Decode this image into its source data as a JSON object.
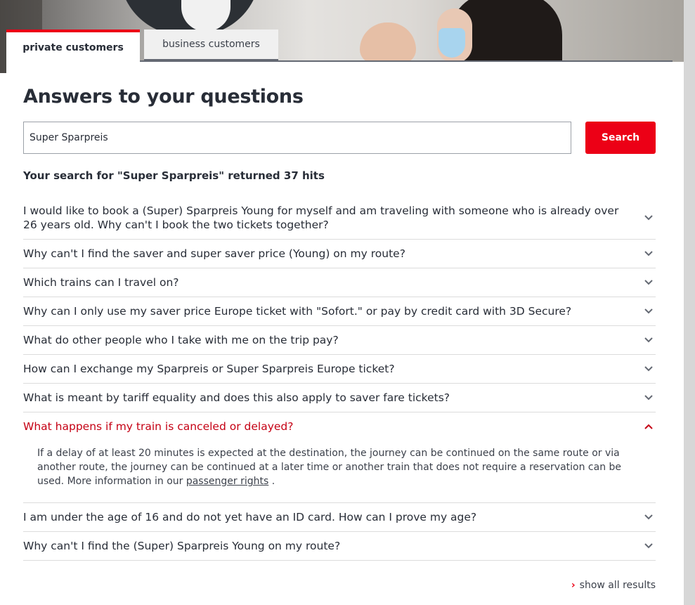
{
  "tabs": {
    "private": "private customers",
    "business": "business customers"
  },
  "page_title": "Answers to your questions",
  "search": {
    "value": "Super Sparpreis",
    "button_label": "Search"
  },
  "result_summary": "Your search for \"Super Sparpreis\" returned 37 hits",
  "faq": [
    {
      "question": "I would like to book a (Super) Sparpreis Young for myself and am traveling with someone who is already over 26 years old. Why can't I book the two tickets together?",
      "open": false
    },
    {
      "question": "Why can't I find the saver and super saver price (Young) on my route?",
      "open": false
    },
    {
      "question": "Which trains can I travel on?",
      "open": false
    },
    {
      "question": "Why can I only use my saver price Europe ticket with \"Sofort.\" or pay by credit card with 3D Secure?",
      "open": false
    },
    {
      "question": "What do other people who I take with me on the trip pay?",
      "open": false
    },
    {
      "question": "How can I exchange my Sparpreis or Super Sparpreis Europe ticket?",
      "open": false
    },
    {
      "question": "What is meant by tariff equality and does this also apply to saver fare tickets?",
      "open": false
    },
    {
      "question": "What happens if my train is canceled or delayed?",
      "open": true,
      "answer": "If a delay of at least 20 minutes is expected at the destination, the journey can be continued on the same route or via another route, the journey can be continued at a later time or another train that does not require a reservation can be used. More information in our",
      "answer_link": "passenger rights",
      "answer_end": "."
    },
    {
      "question": "I am under the age of 16 and do not yet have an ID card. How can I prove my age?",
      "open": false
    },
    {
      "question": "Why can't I find the (Super) Sparpreis Young on my route?",
      "open": false
    }
  ],
  "show_all_label": "show all results",
  "colors": {
    "accent": "#ec0016",
    "open_question": "#c50014",
    "text": "#282d37"
  },
  "icons": {
    "expand": "chevron-down-icon",
    "collapse": "chevron-up-icon",
    "show_all": "chevron-right-icon"
  }
}
